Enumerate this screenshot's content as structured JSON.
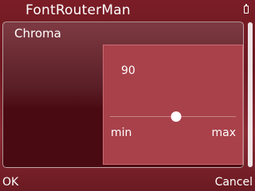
{
  "app": {
    "title": "FontRouterMan"
  },
  "panel": {
    "title": "Chroma"
  },
  "slider": {
    "value": 90,
    "value_text": "90",
    "min_label": "min",
    "max_label": "max",
    "level": 0.52
  },
  "softkeys": {
    "left": "OK",
    "right": "Cancel"
  },
  "colors": {
    "background": "#7a1d26",
    "dialog": "#a8414a",
    "text": "#ffffff"
  },
  "icons": {
    "status": "battery-icon"
  }
}
